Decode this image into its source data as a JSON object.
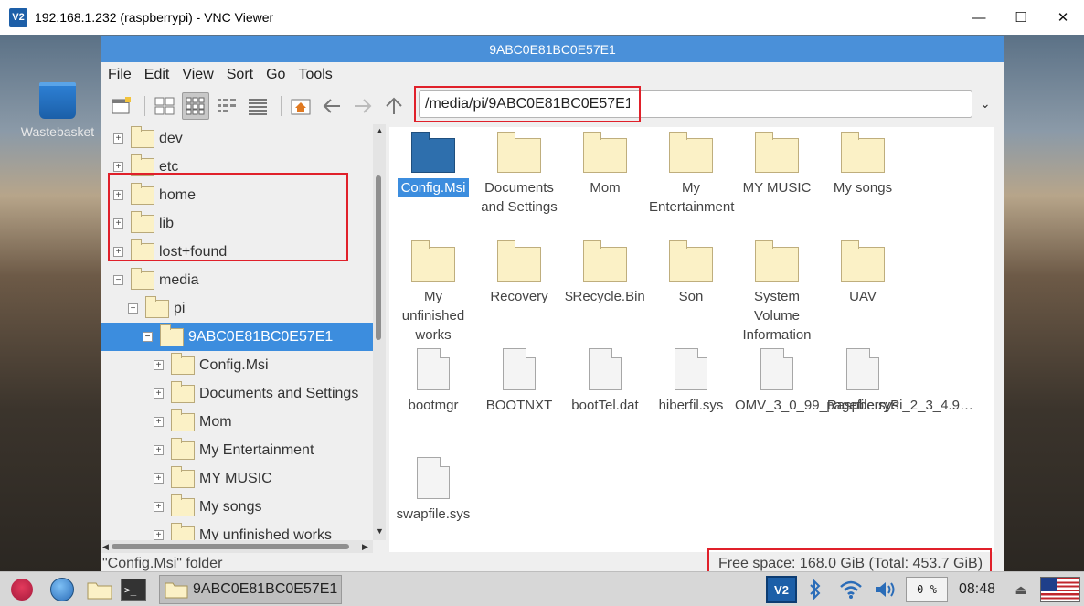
{
  "vnc": {
    "title": "192.168.1.232 (raspberrypi) - VNC Viewer",
    "logo": "V2",
    "controls": [
      "—",
      "☐",
      "✕"
    ]
  },
  "desktop": {
    "wastebasket_label": "Wastebasket"
  },
  "fm": {
    "title": "9ABC0E81BC0E57E1",
    "menu": [
      "File",
      "Edit",
      "View",
      "Sort",
      "Go",
      "Tools"
    ],
    "path": "/media/pi/9ABC0E81BC0E57E1",
    "toolbar_icons": [
      "new-window-icon",
      "icon-view-icon",
      "thumbnail-view-icon",
      "compact-view-icon",
      "detailed-list-icon",
      "home-icon",
      "back-arrow-icon",
      "forward-arrow-icon",
      "up-arrow-icon"
    ],
    "tree": [
      {
        "label": "dev",
        "exp": "+"
      },
      {
        "label": "etc",
        "exp": "+"
      },
      {
        "label": "home",
        "exp": "+"
      },
      {
        "label": "lib",
        "exp": "+"
      },
      {
        "label": "lost+found",
        "exp": "+"
      },
      {
        "label": "media",
        "exp": "−"
      },
      {
        "label": "pi",
        "exp": "−"
      },
      {
        "label": "9ABC0E81BC0E57E1",
        "exp": "−"
      },
      {
        "label": "Config.Msi",
        "exp": "+"
      },
      {
        "label": "Documents and Settings",
        "exp": "+"
      },
      {
        "label": "Mom",
        "exp": "+"
      },
      {
        "label": "My Entertainment",
        "exp": "+"
      },
      {
        "label": "MY MUSIC",
        "exp": "+"
      },
      {
        "label": "My songs",
        "exp": "+"
      },
      {
        "label": "My unfinished works",
        "exp": "+"
      }
    ],
    "items": [
      {
        "label": "Config.Msi",
        "kind": "folder"
      },
      {
        "label": "Documents and Settings",
        "kind": "folder"
      },
      {
        "label": "Mom",
        "kind": "folder"
      },
      {
        "label": "My Entertainment",
        "kind": "folder"
      },
      {
        "label": "MY MUSIC",
        "kind": "folder"
      },
      {
        "label": "My songs",
        "kind": "folder"
      },
      {
        "label": "My unfinished works",
        "kind": "folder"
      },
      {
        "label": "Recovery",
        "kind": "folder"
      },
      {
        "label": "$Recycle.Bin",
        "kind": "folder"
      },
      {
        "label": "Son",
        "kind": "folder"
      },
      {
        "label": "System Volume Information",
        "kind": "folder"
      },
      {
        "label": "UAV",
        "kind": "folder"
      },
      {
        "label": "bootmgr",
        "kind": "file"
      },
      {
        "label": "BOOTNXT",
        "kind": "file"
      },
      {
        "label": "bootTel.dat",
        "kind": "file"
      },
      {
        "label": "hiberfil.sys",
        "kind": "file"
      },
      {
        "label": "OMV_3_0_99_RaspberryPi_2_3_4.9…",
        "kind": "file"
      },
      {
        "label": "pagefile.sys",
        "kind": "file"
      },
      {
        "label": "swapfile.sys",
        "kind": "file"
      }
    ],
    "status_left": "\"Config.Msi\" folder",
    "status_right": "Free space: 168.0 GiB (Total: 453.7 GiB)"
  },
  "taskbar": {
    "task_label": "9ABC0E81BC0E57E1",
    "terminal_glyph": ">_",
    "vnc_tray": "V2",
    "cpu": "0 %",
    "clock": "08:48"
  }
}
